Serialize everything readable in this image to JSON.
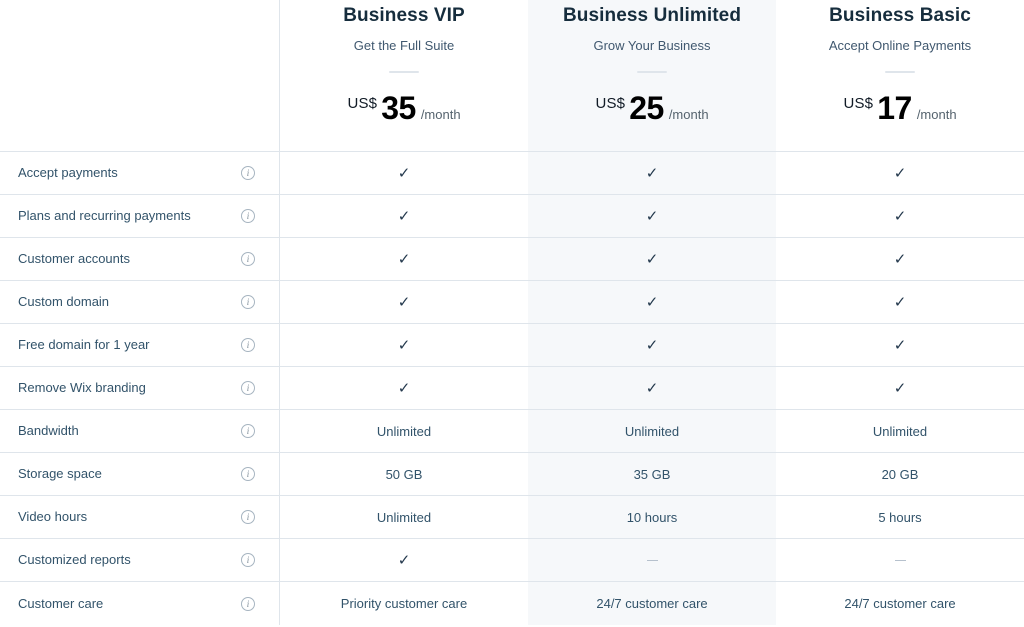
{
  "table": {
    "feature_column_header": "",
    "plans": [
      {
        "name": "Business VIP",
        "tagline": "Get the Full Suite",
        "currency": "US$",
        "price": "35",
        "period": "/month",
        "highlighted": false
      },
      {
        "name": "Business Unlimited",
        "tagline": "Grow Your Business",
        "currency": "US$",
        "price": "25",
        "period": "/month",
        "highlighted": true
      },
      {
        "name": "Business Basic",
        "tagline": "Accept Online Payments",
        "currency": "US$",
        "price": "17",
        "period": "/month",
        "highlighted": false
      }
    ],
    "features": [
      {
        "label": "Accept payments",
        "info_icon": "info-icon",
        "values": [
          "check",
          "check",
          "check"
        ]
      },
      {
        "label": "Plans and recurring payments",
        "info_icon": "info-icon",
        "values": [
          "check",
          "check",
          "check"
        ]
      },
      {
        "label": "Customer accounts",
        "info_icon": "info-icon",
        "values": [
          "check",
          "check",
          "check"
        ]
      },
      {
        "label": "Custom domain",
        "info_icon": "info-icon",
        "values": [
          "check",
          "check",
          "check"
        ]
      },
      {
        "label": "Free domain for 1 year",
        "info_icon": "info-icon",
        "values": [
          "check",
          "check",
          "check"
        ]
      },
      {
        "label": "Remove Wix branding",
        "info_icon": "info-icon",
        "values": [
          "check",
          "check",
          "check"
        ]
      },
      {
        "label": "Bandwidth",
        "info_icon": "info-icon",
        "values": [
          "Unlimited",
          "Unlimited",
          "Unlimited"
        ]
      },
      {
        "label": "Storage space",
        "info_icon": "info-icon",
        "values": [
          "50 GB",
          "35 GB",
          "20 GB"
        ]
      },
      {
        "label": "Video hours",
        "info_icon": "info-icon",
        "values": [
          "Unlimited",
          "10 hours",
          "5 hours"
        ]
      },
      {
        "label": "Customized reports",
        "info_icon": "info-icon",
        "values": [
          "check",
          "dash",
          "dash"
        ]
      },
      {
        "label": "Customer care",
        "info_icon": "info-icon",
        "values": [
          "Priority customer care",
          "24/7 customer care",
          "24/7 customer care"
        ]
      }
    ]
  },
  "colors": {
    "border": "#dfe5eb",
    "highlight_column_bg": "#f6f8fa",
    "plan_name": "#162d3d",
    "tagline": "#40586f",
    "feature_label": "#32536a",
    "check": "#24394d",
    "dash": "#b6c1cd",
    "price": "#000000"
  },
  "glyphs": {
    "check": "✓",
    "info": "i"
  }
}
